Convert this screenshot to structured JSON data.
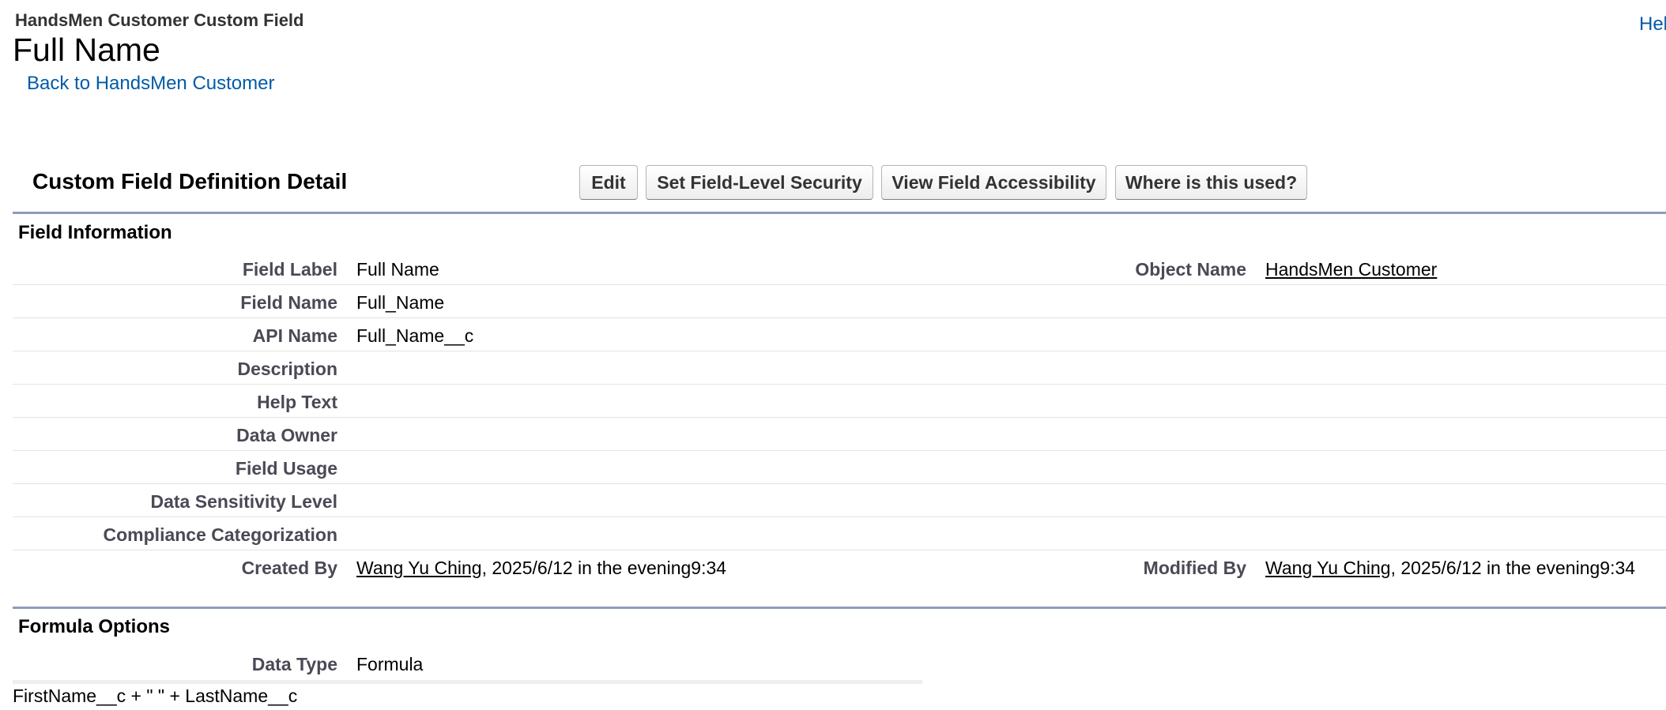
{
  "header": {
    "object_type": "HandsMen Customer Custom Field",
    "title": "Full Name",
    "back_link": "Back to HandsMen Customer",
    "help_link": "Hel"
  },
  "detail": {
    "title": "Custom Field Definition Detail",
    "buttons": {
      "edit": "Edit",
      "set_fls": "Set Field-Level Security",
      "view_accessibility": "View Field Accessibility",
      "where_used": "Where is this used?"
    }
  },
  "field_information": {
    "title": "Field Information",
    "field_label": {
      "label": "Field Label",
      "value": "Full Name"
    },
    "object_name": {
      "label": "Object Name",
      "value": "HandsMen Customer"
    },
    "field_name": {
      "label": "Field Name",
      "value": "Full_Name"
    },
    "api_name": {
      "label": "API Name",
      "value": "Full_Name__c"
    },
    "description": {
      "label": "Description",
      "value": ""
    },
    "help_text": {
      "label": "Help Text",
      "value": ""
    },
    "data_owner": {
      "label": "Data Owner",
      "value": ""
    },
    "field_usage": {
      "label": "Field Usage",
      "value": ""
    },
    "data_sensitivity": {
      "label": "Data Sensitivity Level",
      "value": ""
    },
    "compliance": {
      "label": "Compliance Categorization",
      "value": ""
    },
    "created_by": {
      "label": "Created By",
      "user": "Wang Yu Ching",
      "date": ", 2025/6/12 in the evening9:34"
    },
    "modified_by": {
      "label": "Modified By",
      "user": "Wang Yu Ching",
      "date": ", 2025/6/12 in the evening9:34"
    }
  },
  "formula_options": {
    "title": "Formula Options",
    "data_type": {
      "label": "Data Type",
      "value": "Formula"
    },
    "formula": "FirstName__c + \" \" + LastName__c"
  },
  "colors": {
    "link_blue": "#015ba7",
    "section_rule": "#8e9dbe",
    "label_gray": "#4a4a56"
  }
}
